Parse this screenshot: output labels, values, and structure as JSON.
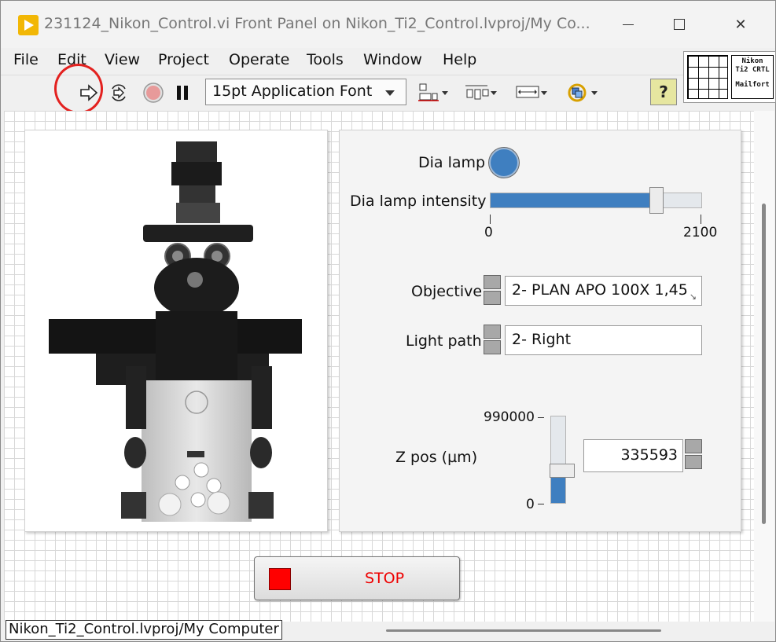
{
  "window": {
    "title": "231124_Nikon_Control.vi Front Panel on Nikon_Ti2_Control.lvproj/My Co...",
    "minimize": "minimize-icon",
    "maximize": "maximize-icon",
    "close": "✕"
  },
  "menu": [
    "File",
    "Edit",
    "View",
    "Project",
    "Operate",
    "Tools",
    "Window",
    "Help"
  ],
  "toolbar": {
    "font": "15pt Application Font",
    "help": "?"
  },
  "vi_icon": {
    "line1": "Nikon",
    "line2": "Ti2 CRTL",
    "line3": "Mailfort"
  },
  "controls": {
    "dia_lamp_label": "Dia lamp",
    "dia_lamp_on": true,
    "dia_lamp_color": "#3f7fc0",
    "intensity_label": "Dia lamp intensity",
    "intensity_min": "0",
    "intensity_max": "2100",
    "intensity_fraction": 0.8,
    "objective_label": "Objective",
    "objective_value": "2- PLAN APO 100X 1,45",
    "lightpath_label": "Light path",
    "lightpath_value": "2- Right",
    "zpos_label": "Z pos (µm)",
    "zpos_max": "990000",
    "zpos_min": "0",
    "zpos_value": "335593",
    "zpos_fraction": 0.34,
    "stop_label": "STOP"
  },
  "status": "Nikon_Ti2_Control.lvproj/My Computer"
}
